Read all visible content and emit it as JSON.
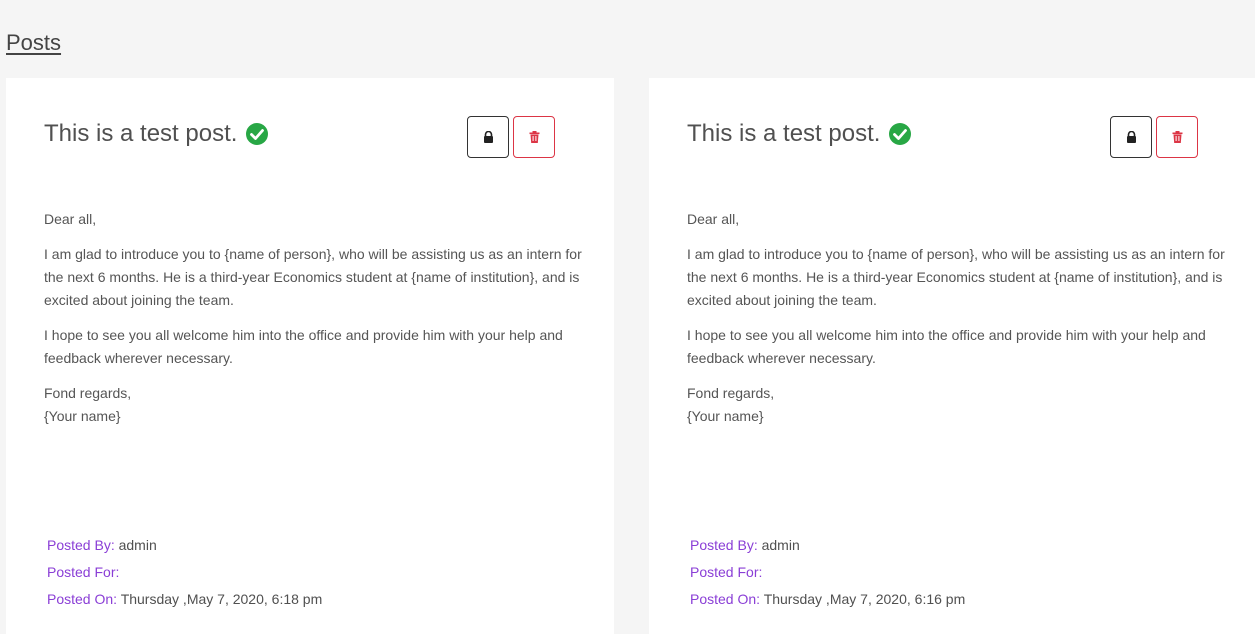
{
  "header": {
    "posts_link": "Posts"
  },
  "colors": {
    "accent_purple": "#8a3ed6",
    "verified_green": "#28a745",
    "danger_red": "#dc3545"
  },
  "posts": [
    {
      "title": "This is a test post.",
      "verified_icon": "check-circle-icon",
      "lock_icon": "lock-icon",
      "delete_icon": "trash-icon",
      "greeting": "Dear all,",
      "paragraph1": "I am glad to introduce you to {name of person}, who will be assisting us as an intern for the next 6 months. He is a third-year Economics student at {name of institution}, and is excited about joining the team.",
      "paragraph2": "I hope to see you all welcome him into the office and provide him with your help and feedback wherever necessary.",
      "closing": "Fond regards,",
      "signature": "{Your name}",
      "posted_by_label": "Posted By:",
      "posted_by_value": "admin",
      "posted_for_label": "Posted For:",
      "posted_for_value": "",
      "posted_on_label": "Posted On:",
      "posted_on_value": "Thursday ,May 7, 2020, 6:18 pm"
    },
    {
      "title": "This is a test post.",
      "verified_icon": "check-circle-icon",
      "lock_icon": "lock-icon",
      "delete_icon": "trash-icon",
      "greeting": "Dear all,",
      "paragraph1": "I am glad to introduce you to {name of person}, who will be assisting us as an intern for the next 6 months. He is a third-year Economics student at {name of institution}, and is excited about joining the team.",
      "paragraph2": "I hope to see you all welcome him into the office and provide him with your help and feedback wherever necessary.",
      "closing": "Fond regards,",
      "signature": "{Your name}",
      "posted_by_label": "Posted By:",
      "posted_by_value": "admin",
      "posted_for_label": "Posted For:",
      "posted_for_value": "",
      "posted_on_label": "Posted On:",
      "posted_on_value": "Thursday ,May 7, 2020, 6:16 pm"
    }
  ]
}
